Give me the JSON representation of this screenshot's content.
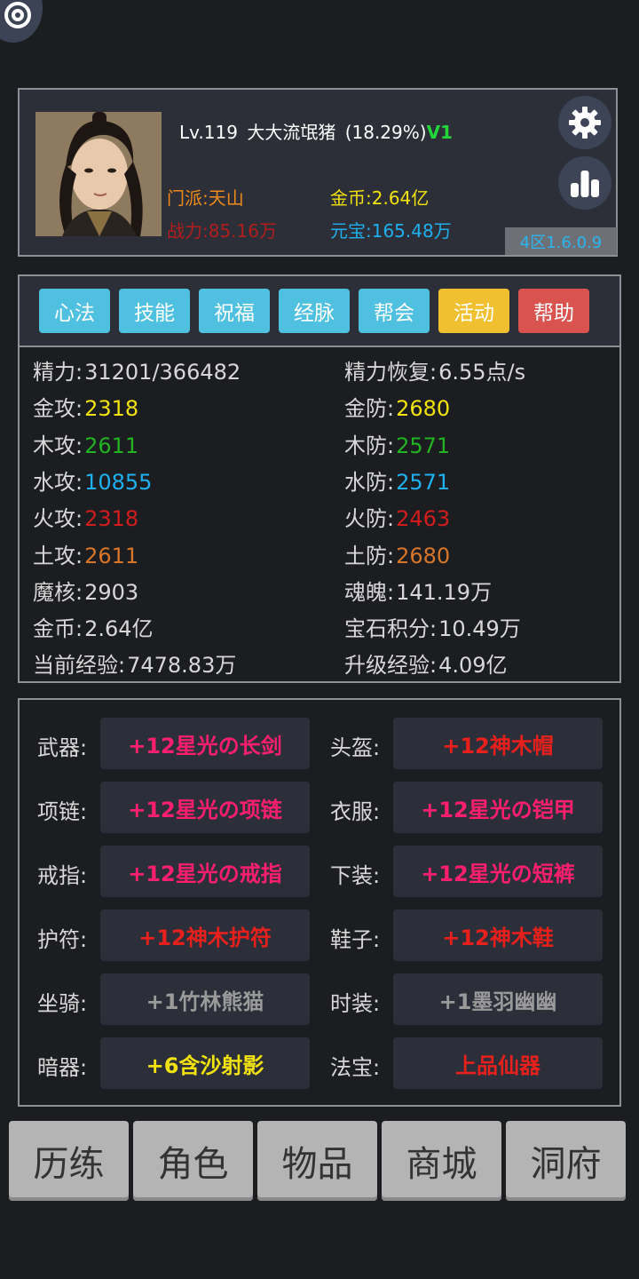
{
  "colors": {
    "background": "#1c1d20",
    "panel": "#2c2f37",
    "border": "#8d8f94",
    "metal": "#f2e20e",
    "wood": "#22b322",
    "water": "#1fb0ef",
    "fire": "#d21d1d",
    "earth": "#d8762a"
  },
  "corner_icon": "at-sign-icon",
  "profile": {
    "level": "Lv.119",
    "name": "大大流氓猪",
    "exp_percent": "(18.29%)",
    "vip": "V1",
    "sect": "门派:天山",
    "power": "战力:85.16万",
    "gold": "金币:2.64亿",
    "yuanbao": "元宝:165.48万",
    "version": "4区1.6.0.9",
    "settings_icon": "gear-icon",
    "stats_icon": "bar-chart-icon"
  },
  "tabs": [
    {
      "label": "心法",
      "color": "#4fc0e0"
    },
    {
      "label": "技能",
      "color": "#4fc0e0"
    },
    {
      "label": "祝福",
      "color": "#4fc0e0"
    },
    {
      "label": "经脉",
      "color": "#4fc0e0"
    },
    {
      "label": "帮会",
      "color": "#4fc0e0"
    },
    {
      "label": "活动",
      "color": "#f0c030"
    },
    {
      "label": "帮助",
      "color": "#d9534f"
    }
  ],
  "stats": [
    {
      "label": "精力:",
      "value": "31201/366482",
      "color": "#d8d8d8"
    },
    {
      "label": "精力恢复:",
      "value": "6.55点/s",
      "color": "#d8d8d8"
    },
    {
      "label": "金攻:",
      "value": "2318",
      "color": "#f2e20e"
    },
    {
      "label": "金防:",
      "value": "2680",
      "color": "#f2e20e"
    },
    {
      "label": "木攻:",
      "value": "2611",
      "color": "#22b322"
    },
    {
      "label": "木防:",
      "value": "2571",
      "color": "#22b322"
    },
    {
      "label": "水攻:",
      "value": "10855",
      "color": "#1fb0ef"
    },
    {
      "label": "水防:",
      "value": "2571",
      "color": "#1fb0ef"
    },
    {
      "label": "火攻:",
      "value": "2318",
      "color": "#d21d1d"
    },
    {
      "label": "火防:",
      "value": "2463",
      "color": "#d21d1d"
    },
    {
      "label": "土攻:",
      "value": "2611",
      "color": "#d8762a"
    },
    {
      "label": "土防:",
      "value": "2680",
      "color": "#d8762a"
    },
    {
      "label": "魔核:",
      "value": "2903",
      "color": "#d8d8d8"
    },
    {
      "label": "魂魄:",
      "value": "141.19万",
      "color": "#d8d8d8"
    },
    {
      "label": "金币:",
      "value": "2.64亿",
      "color": "#d8d8d8"
    },
    {
      "label": "宝石积分:",
      "value": "10.49万",
      "color": "#d8d8d8"
    },
    {
      "label": "当前经验:",
      "value": "7478.83万",
      "color": "#d8d8d8"
    },
    {
      "label": "升级经验:",
      "value": "4.09亿",
      "color": "#d8d8d8"
    }
  ],
  "equipment": [
    {
      "slot": "武器:",
      "item": "+12星光の长剑",
      "color": "#ff1f6e"
    },
    {
      "slot": "头盔:",
      "item": "+12神木帽",
      "color": "#e8201c"
    },
    {
      "slot": "项链:",
      "item": "+12星光の项链",
      "color": "#ff1f6e"
    },
    {
      "slot": "衣服:",
      "item": "+12星光の铠甲",
      "color": "#ff1f6e"
    },
    {
      "slot": "戒指:",
      "item": "+12星光の戒指",
      "color": "#ff1f6e"
    },
    {
      "slot": "下装:",
      "item": "+12星光の短裤",
      "color": "#ff1f6e"
    },
    {
      "slot": "护符:",
      "item": "+12神木护符",
      "color": "#e8201c"
    },
    {
      "slot": "鞋子:",
      "item": "+12神木鞋",
      "color": "#e8201c"
    },
    {
      "slot": "坐骑:",
      "item": "+1竹林熊猫",
      "color": "#9a9a9a"
    },
    {
      "slot": "时装:",
      "item": "+1墨羽幽幽",
      "color": "#9a9a9a"
    },
    {
      "slot": "暗器:",
      "item": "+6含沙射影",
      "color": "#f2e20e"
    },
    {
      "slot": "法宝:",
      "item": "上品仙器",
      "color": "#e8201c"
    }
  ],
  "nav": [
    {
      "label": "历练"
    },
    {
      "label": "角色"
    },
    {
      "label": "物品"
    },
    {
      "label": "商城"
    },
    {
      "label": "洞府"
    }
  ]
}
